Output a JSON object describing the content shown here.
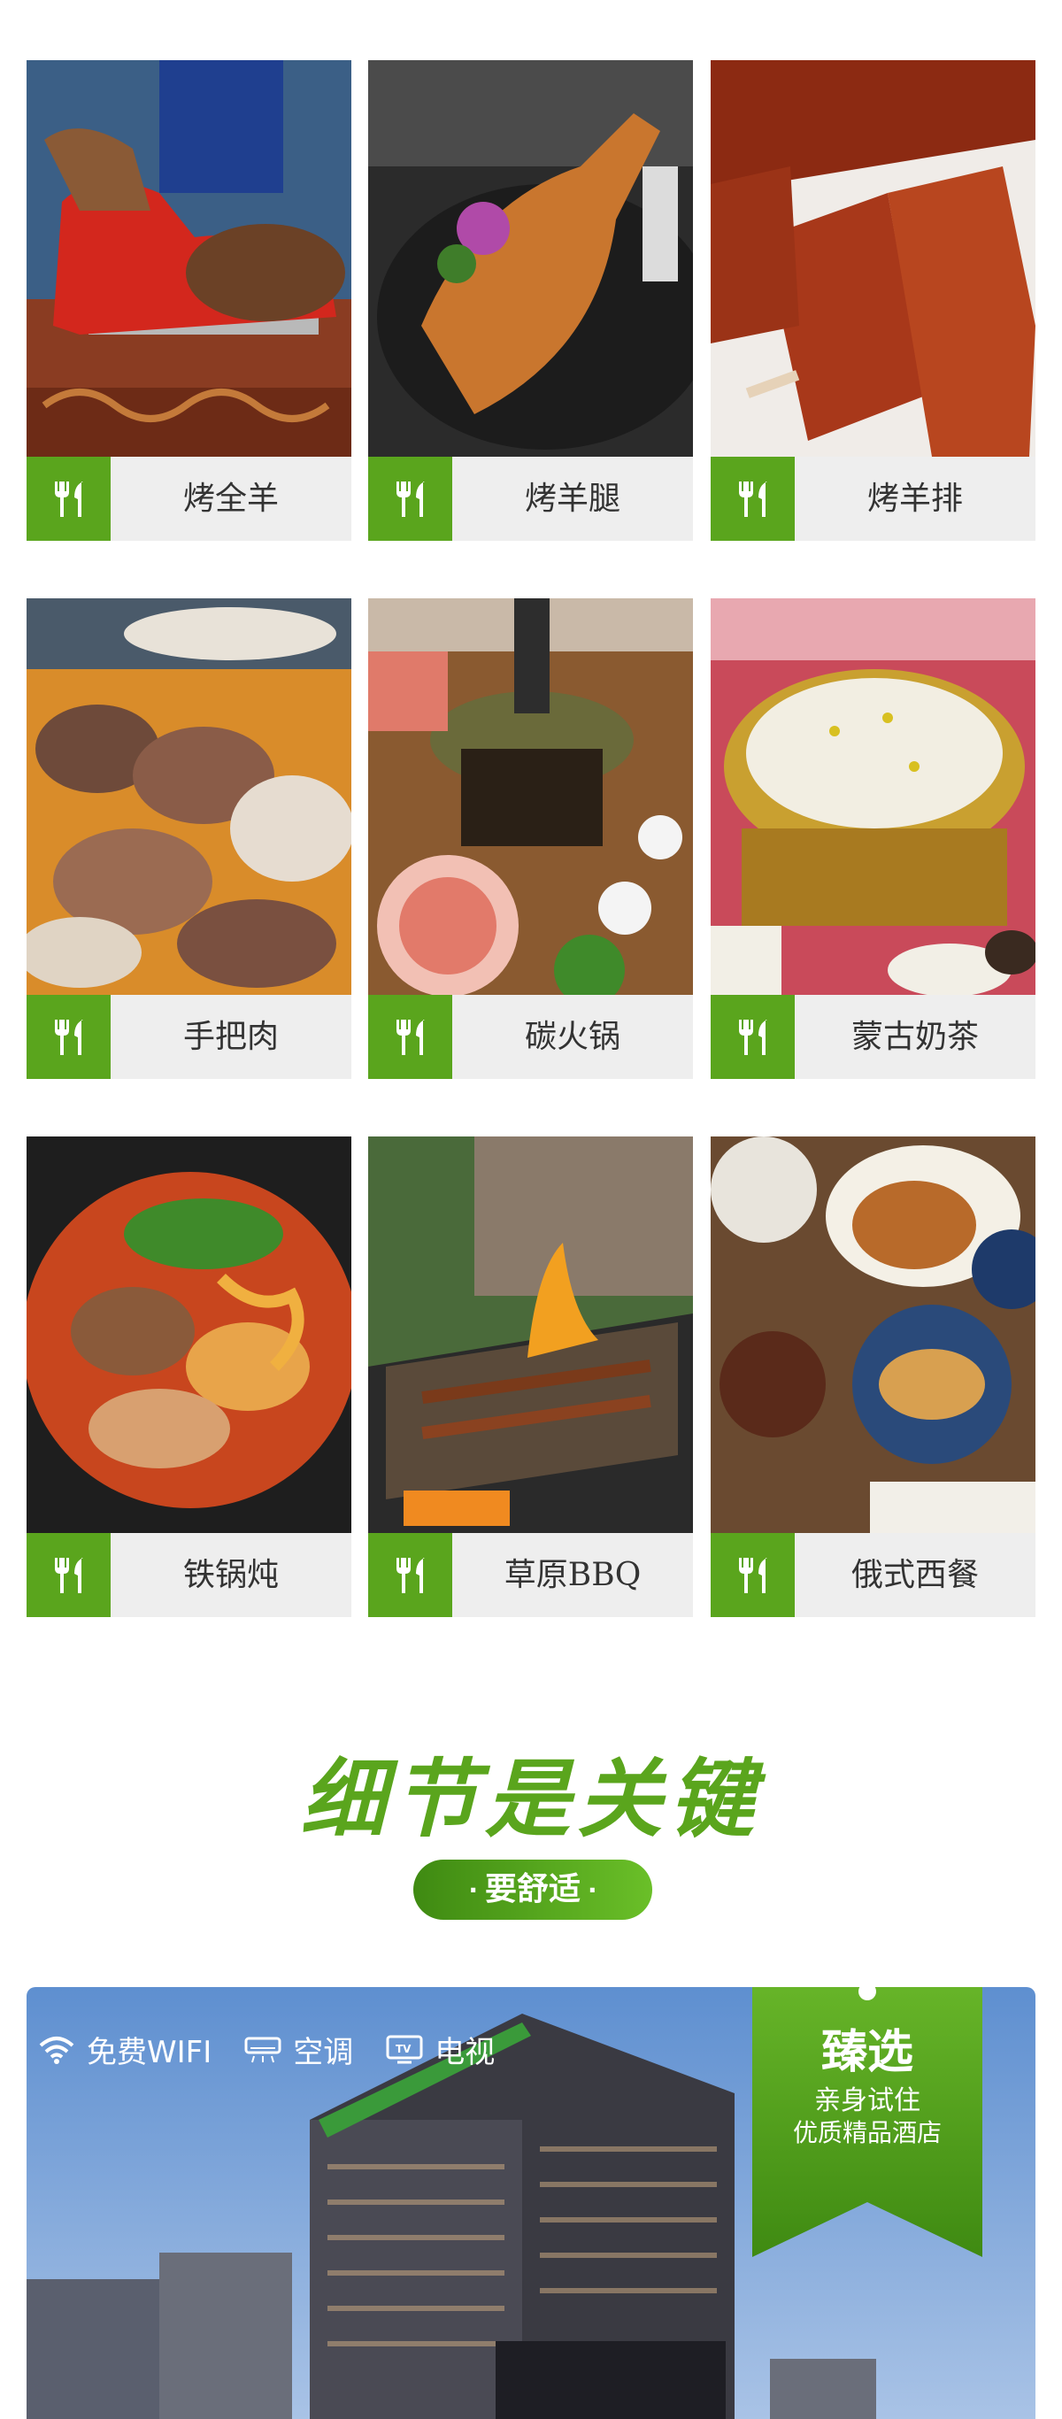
{
  "foods": [
    {
      "label": "烤全羊",
      "icon": "fork-knife-icon"
    },
    {
      "label": "烤羊腿",
      "icon": "fork-knife-icon"
    },
    {
      "label": "烤羊排",
      "icon": "fork-knife-icon"
    },
    {
      "label": "手把肉",
      "icon": "fork-knife-icon"
    },
    {
      "label": "碳火锅",
      "icon": "fork-knife-icon"
    },
    {
      "label": "蒙古奶茶",
      "icon": "fork-knife-icon"
    },
    {
      "label": "铁锅炖",
      "icon": "fork-knife-icon"
    },
    {
      "label": "草原BBQ",
      "icon": "fork-knife-icon"
    },
    {
      "label": "俄式西餐",
      "icon": "fork-knife-icon"
    }
  ],
  "section": {
    "title": "细节是关键",
    "pill_text": "要舒适",
    "pill_dot": "·"
  },
  "hotel": {
    "amenities": [
      {
        "label": "免费WIFI",
        "icon": "wifi-icon"
      },
      {
        "label": "空调",
        "icon": "air-conditioner-icon"
      },
      {
        "label": "电视",
        "icon": "tv-icon"
      }
    ],
    "badge": {
      "title": "臻选",
      "line1": "亲身试住",
      "line2": "优质精品酒店"
    }
  },
  "colors": {
    "brand_green": "#5aa51d",
    "label_bg": "#eeeeee",
    "sky_blue": "#7ea7d8"
  }
}
